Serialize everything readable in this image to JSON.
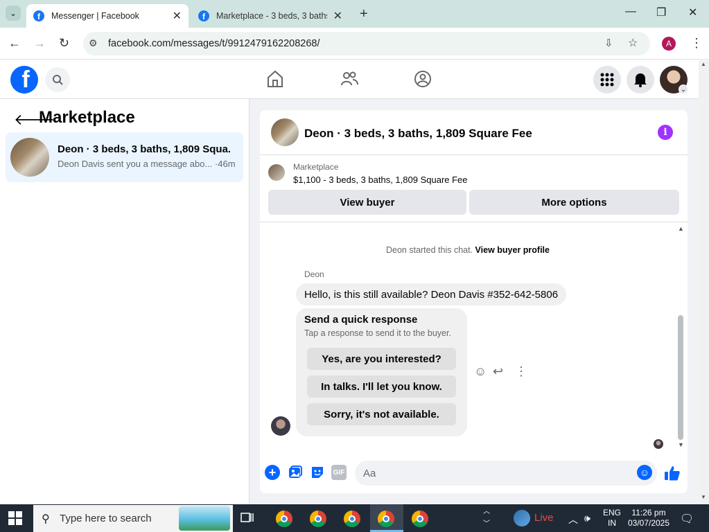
{
  "browser": {
    "tabs": [
      {
        "title": "Messenger | Facebook",
        "active": true
      },
      {
        "title": "Marketplace - 3 beds, 3 baths,",
        "active": false
      }
    ],
    "url": "facebook.com/messages/t/9912479162208268/",
    "profile_initial": "A"
  },
  "fb": {
    "logo_letter": "f"
  },
  "sidebar": {
    "title": "Marketplace",
    "conversations": [
      {
        "title": "Deon · 3 beds, 3 baths, 1,809 Squa...",
        "subtitle": "Deon Davis sent you a message abo... ·46m"
      }
    ]
  },
  "chat": {
    "title": "Deon · 3 beds, 3 baths, 1,809 Square Fee",
    "listing_label": "Marketplace",
    "listing_price": "$1,100 - 3 beds, 3 baths, 1,809 Square Fee",
    "view_buyer_label": "View buyer",
    "more_options_label": "More options",
    "started_text": "Deon started this chat.",
    "view_profile_link": "View buyer profile",
    "sender_name": "Deon",
    "message": "Hello, is this still available? Deon Davis #352-642-5806",
    "quick_title": "Send a quick response",
    "quick_subtitle": "Tap a response to send it to the buyer.",
    "quick_responses": [
      "Yes, are you interested?",
      "In talks. I'll let you know.",
      "Sorry, it's not available."
    ],
    "composer_placeholder": "Aa",
    "gif_label": "GIF"
  },
  "taskbar": {
    "search_placeholder": "Type here to search",
    "live_label": "Live",
    "lang_line1": "ENG",
    "lang_line2": "IN",
    "time": "11:26 pm",
    "date": "03/07/2025"
  },
  "colors": {
    "accent": "#0866ff",
    "info": "#a033ff",
    "highlight_row": "#ebf5ff"
  }
}
